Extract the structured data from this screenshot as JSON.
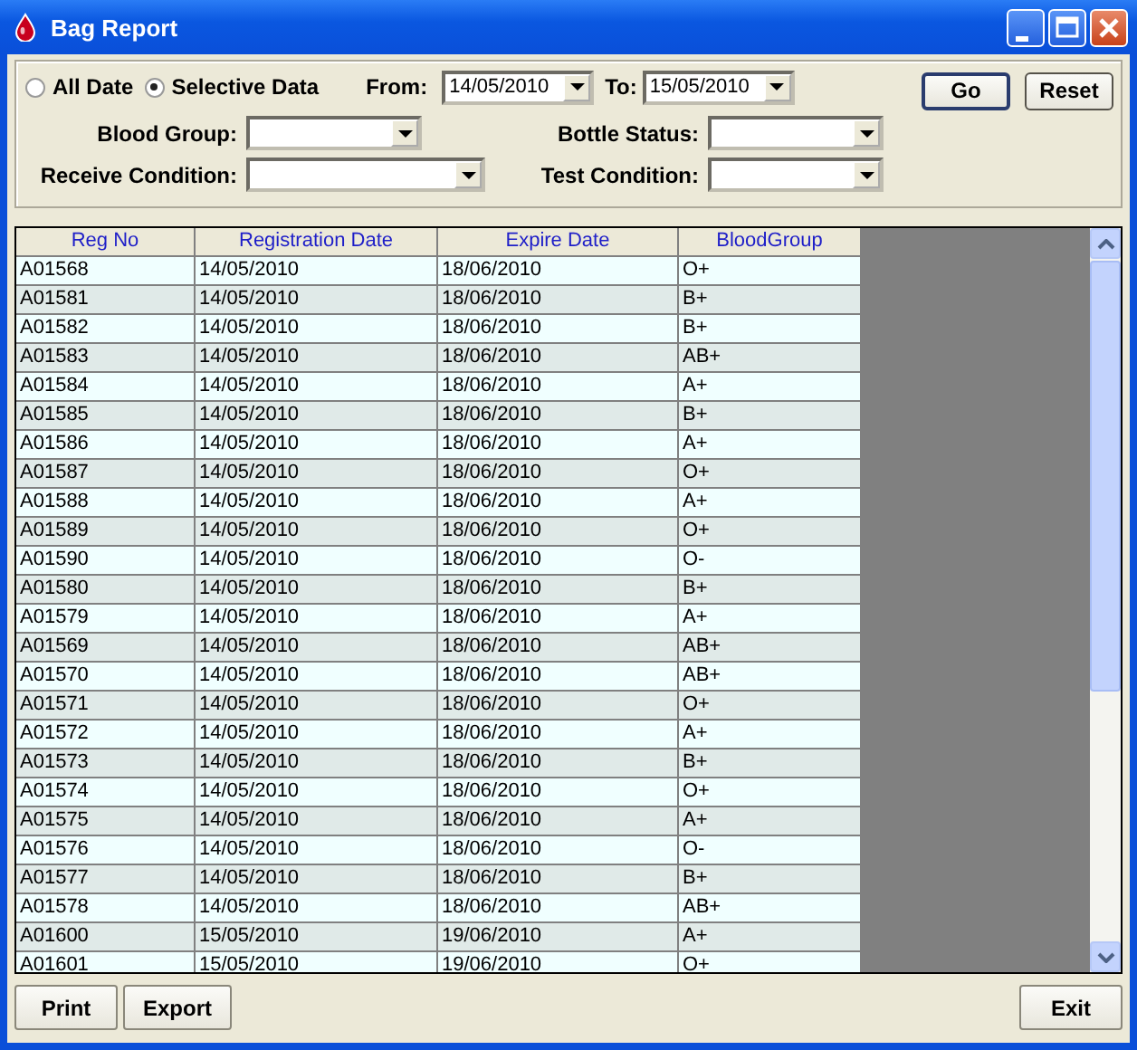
{
  "window": {
    "title": "Bag Report"
  },
  "date_mode": [
    {
      "label": "All Date",
      "selected": false
    },
    {
      "label": "Selective Data",
      "selected": true
    }
  ],
  "from": {
    "label": "From:",
    "value": "14/05/2010"
  },
  "to": {
    "label": "To:",
    "value": "15/05/2010"
  },
  "actions": [
    "Go",
    "Reset"
  ],
  "filters": [
    {
      "label": "Blood Group:",
      "wide": false
    },
    {
      "label": "Bottle Status:",
      "wide": false
    },
    {
      "label": "Receive Condition:",
      "wide": true
    },
    {
      "label": "Test Condition:",
      "wide": false
    }
  ],
  "table": {
    "columns": [
      "Reg No",
      "Registration Date",
      "Expire Date",
      "BloodGroup"
    ],
    "rows": [
      [
        "A01568",
        "14/05/2010",
        "18/06/2010",
        "O+"
      ],
      [
        "A01581",
        "14/05/2010",
        "18/06/2010",
        "B+"
      ],
      [
        "A01582",
        "14/05/2010",
        "18/06/2010",
        "B+"
      ],
      [
        "A01583",
        "14/05/2010",
        "18/06/2010",
        "AB+"
      ],
      [
        "A01584",
        "14/05/2010",
        "18/06/2010",
        "A+"
      ],
      [
        "A01585",
        "14/05/2010",
        "18/06/2010",
        "B+"
      ],
      [
        "A01586",
        "14/05/2010",
        "18/06/2010",
        "A+"
      ],
      [
        "A01587",
        "14/05/2010",
        "18/06/2010",
        "O+"
      ],
      [
        "A01588",
        "14/05/2010",
        "18/06/2010",
        "A+"
      ],
      [
        "A01589",
        "14/05/2010",
        "18/06/2010",
        "O+"
      ],
      [
        "A01590",
        "14/05/2010",
        "18/06/2010",
        "O-"
      ],
      [
        "A01580",
        "14/05/2010",
        "18/06/2010",
        "B+"
      ],
      [
        "A01579",
        "14/05/2010",
        "18/06/2010",
        "A+"
      ],
      [
        "A01569",
        "14/05/2010",
        "18/06/2010",
        "AB+"
      ],
      [
        "A01570",
        "14/05/2010",
        "18/06/2010",
        "AB+"
      ],
      [
        "A01571",
        "14/05/2010",
        "18/06/2010",
        "O+"
      ],
      [
        "A01572",
        "14/05/2010",
        "18/06/2010",
        "A+"
      ],
      [
        "A01573",
        "14/05/2010",
        "18/06/2010",
        "B+"
      ],
      [
        "A01574",
        "14/05/2010",
        "18/06/2010",
        "O+"
      ],
      [
        "A01575",
        "14/05/2010",
        "18/06/2010",
        "A+"
      ],
      [
        "A01576",
        "14/05/2010",
        "18/06/2010",
        "O-"
      ],
      [
        "A01577",
        "14/05/2010",
        "18/06/2010",
        "B+"
      ],
      [
        "A01578",
        "14/05/2010",
        "18/06/2010",
        "AB+"
      ],
      [
        "A01600",
        "15/05/2010",
        "19/06/2010",
        "A+"
      ],
      [
        "A01601",
        "15/05/2010",
        "19/06/2010",
        "O+"
      ]
    ]
  },
  "bottom_left": [
    "Print",
    "Export"
  ],
  "bottom_right": [
    "Exit"
  ]
}
